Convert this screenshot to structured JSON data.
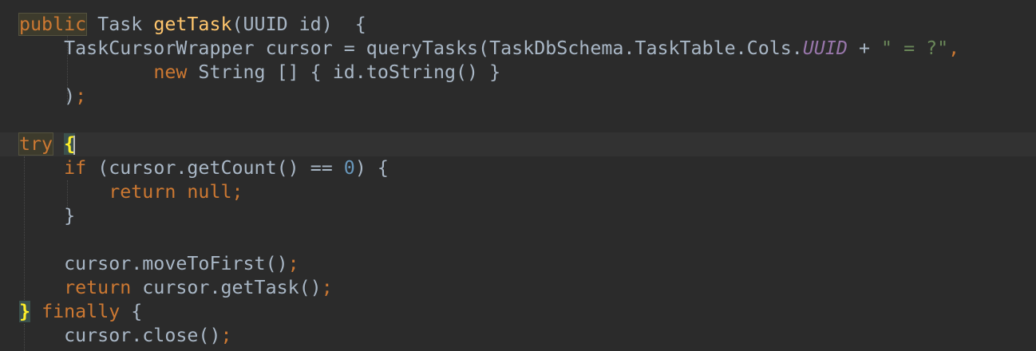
{
  "editor": {
    "lines": [
      {
        "tokens": [
          {
            "t": "public",
            "c": "kw hl-kw"
          },
          {
            "t": " Task ",
            "c": "plain"
          },
          {
            "t": "getTask",
            "c": "fn"
          },
          {
            "t": "(UUID id)  {",
            "c": "plain"
          }
        ]
      },
      {
        "tokens": [
          {
            "t": "    TaskCursorWrapper cursor = queryTasks(TaskDbSchema.TaskTable.Cols.",
            "c": "plain"
          },
          {
            "t": "UUID",
            "c": "const"
          },
          {
            "t": " + ",
            "c": "plain"
          },
          {
            "t": "\" = ?\"",
            "c": "str"
          },
          {
            "t": ",",
            "c": "kw"
          }
        ]
      },
      {
        "tokens": [
          {
            "t": "            ",
            "c": "plain"
          },
          {
            "t": "new",
            "c": "kw"
          },
          {
            "t": " String [] { id.toString() }",
            "c": "plain"
          }
        ]
      },
      {
        "tokens": [
          {
            "t": "    )",
            "c": "plain"
          },
          {
            "t": ";",
            "c": "kw"
          }
        ]
      },
      {
        "tokens": []
      },
      {
        "current": true,
        "tokens": [
          {
            "t": "try",
            "c": "kw hl-kw"
          },
          {
            "t": " ",
            "c": "plain"
          },
          {
            "t": "{",
            "c": "brace-match"
          }
        ]
      },
      {
        "tokens": [
          {
            "t": "    ",
            "c": "plain"
          },
          {
            "t": "if",
            "c": "kw"
          },
          {
            "t": " (cursor.getCount() == ",
            "c": "plain"
          },
          {
            "t": "0",
            "c": "num"
          },
          {
            "t": ") {",
            "c": "plain"
          }
        ]
      },
      {
        "tokens": [
          {
            "t": "        ",
            "c": "plain"
          },
          {
            "t": "return null",
            "c": "kw"
          },
          {
            "t": ";",
            "c": "kw"
          }
        ]
      },
      {
        "tokens": [
          {
            "t": "    }",
            "c": "plain"
          }
        ]
      },
      {
        "tokens": []
      },
      {
        "tokens": [
          {
            "t": "    cursor.moveToFirst()",
            "c": "plain"
          },
          {
            "t": ";",
            "c": "kw"
          }
        ]
      },
      {
        "tokens": [
          {
            "t": "    ",
            "c": "plain"
          },
          {
            "t": "return",
            "c": "kw"
          },
          {
            "t": " cursor.getTask()",
            "c": "plain"
          },
          {
            "t": ";",
            "c": "kw"
          }
        ]
      },
      {
        "tokens": [
          {
            "t": "}",
            "c": "brace-match"
          },
          {
            "t": " ",
            "c": "plain"
          },
          {
            "t": "finally",
            "c": "kw"
          },
          {
            "t": " {",
            "c": "plain"
          }
        ]
      },
      {
        "tokens": [
          {
            "t": "    cursor.close()",
            "c": "plain"
          },
          {
            "t": ";",
            "c": "kw"
          }
        ]
      }
    ]
  },
  "colors": {
    "background": "#2b2b2b",
    "keyword": "#cc7832",
    "method": "#ffc66d",
    "string": "#6a8759",
    "number": "#6897bb",
    "constant": "#9876aa",
    "text": "#a9b7c6"
  }
}
